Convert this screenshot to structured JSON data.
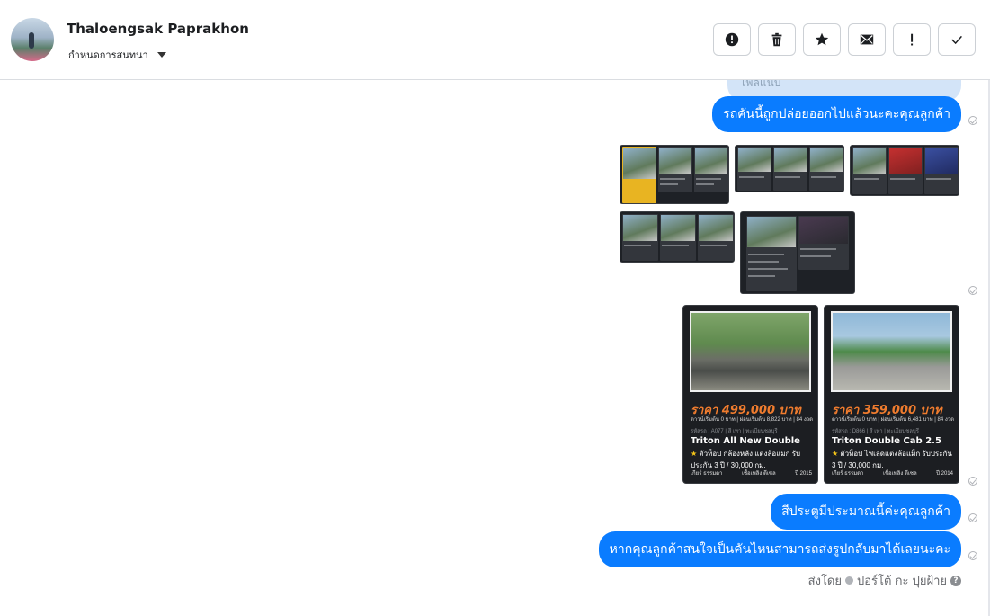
{
  "header": {
    "contact_name": "Thaloengsak Paprakhon",
    "assign_label": "กำหนดการสนทนา",
    "actions": [
      {
        "name": "report-icon",
        "glyph": "!"
      },
      {
        "name": "trash-icon"
      },
      {
        "name": "star-icon"
      },
      {
        "name": "mail-icon"
      },
      {
        "name": "important-icon",
        "glyph": "!"
      },
      {
        "name": "done-icon"
      }
    ]
  },
  "thread": {
    "previous_partial": "ไฟล์แนบ",
    "messages": [
      {
        "text": "รถคันนี้ถูกปล่อยออกไปแล้วนะคะคุณลูกค้า"
      },
      {
        "text": "สีประตูมีประมาณนี้ค่ะคุณลูกค้า"
      },
      {
        "text": "หากคุณลูกค้าสนใจเป็นคันไหนสามารถส่งรูปกลับมาได้เลยนะคะ"
      }
    ],
    "cards": [
      {
        "price": "ราคา 499,000 บาท",
        "down": "ดาวน์เริ่มต้น 0 บาท | ผ่อนเริ่มต้น 8,822 บาท | 84 งวด",
        "code": "รหัสรถ : A077 | สี เทา | ทะเบียนชลบุรี",
        "model": "Triton All New Double",
        "desc": "ตัวท็อป กล้องหลัง แต่งล้อแมก รับประกัน 3 ปี / 30,000 กม.",
        "footer": [
          "เกียร์ ธรรมดา",
          "เชื้อเพลิง ดีเซล",
          "ปี 2015"
        ]
      },
      {
        "price": "ราคา 359,000 บาท",
        "down": "ดาวน์เริ่มต้น 0 บาท | ผ่อนเริ่มต้น 6,481 บาท | 84 งวด",
        "code": "รหัสรถ : D866 | สี เทา | ทะเบียนชลบุรี",
        "model": "Triton Double Cab 2.5",
        "desc": "ตัวท็อป ไฟเลดแต่งล้อแม็ก รับประกัน 3 ปี / 30,000 กม.",
        "footer": [
          "เกียร์ ธรรมดา",
          "เชื้อเพลิง ดีเซล",
          "ปี 2014"
        ]
      }
    ],
    "sent_by_prefix": "ส่งโดย",
    "sent_by_name": "ปอร์โต้ กะ ปุยฝ้าย"
  }
}
